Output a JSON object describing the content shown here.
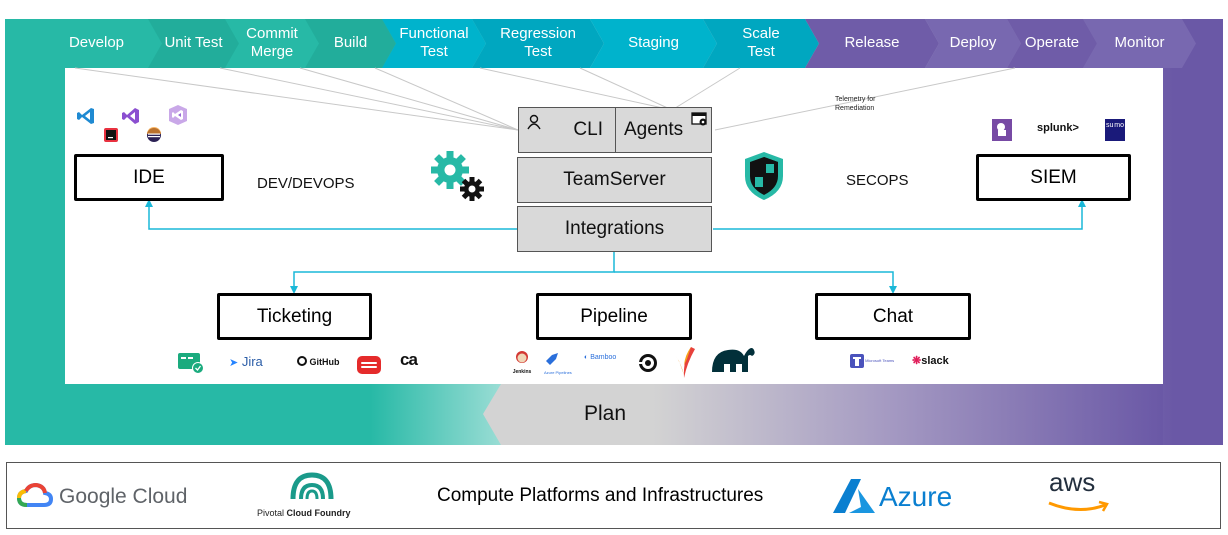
{
  "stages": [
    {
      "label": "Develop",
      "phase": "dev"
    },
    {
      "label": "Unit Test",
      "phase": "dev"
    },
    {
      "label": "Commit\nMerge",
      "phase": "dev"
    },
    {
      "label": "Build",
      "phase": "dev"
    },
    {
      "label": "Functional\nTest",
      "phase": "test"
    },
    {
      "label": "Regression\nTest",
      "phase": "test"
    },
    {
      "label": "Staging",
      "phase": "test"
    },
    {
      "label": "Scale\nTest",
      "phase": "test"
    },
    {
      "label": "Release",
      "phase": "ops"
    },
    {
      "label": "Deploy",
      "phase": "ops"
    },
    {
      "label": "Operate",
      "phase": "ops"
    },
    {
      "label": "Monitor",
      "phase": "ops"
    }
  ],
  "colors": {
    "dev": "#27b9a6",
    "test": "#00b3cc",
    "ops": "#6f5ca8",
    "connector": "#1ab8d8",
    "core_box": "#d9d9d9",
    "fan_line": "#c8c8c8"
  },
  "core": {
    "cli": "CLI",
    "agents": "Agents",
    "teamserver": "TeamServer",
    "integrations": "Integrations"
  },
  "left": {
    "ide": "IDE",
    "devops_label": "DEV/DEVOPS",
    "ide_logos": [
      "vscode-icon",
      "visual-studio-icon",
      "visual-studio-alt-icon",
      "intellij-icon",
      "eclipse-icon"
    ]
  },
  "right": {
    "siem": "SIEM",
    "secops_label": "SECOPS",
    "telemetry_label": "Telemetry for\nRemediation",
    "siem_logos": [
      "datadog-icon",
      "splunk",
      "sumo-logic-icon"
    ],
    "splunk_text": "splunk>",
    "sumo_text": "su mo"
  },
  "bottom_targets": [
    {
      "label": "Ticketing",
      "logos": [
        "azure-boards-icon",
        "Jira",
        "GitHub",
        "redhat-icon",
        "ca"
      ]
    },
    {
      "label": "Pipeline",
      "logos": [
        "jenkins-icon",
        "Azure Pipelines",
        "Bamboo",
        "circleci-icon",
        "apache-maven-icon",
        "gradle-elephant-icon"
      ]
    },
    {
      "label": "Chat",
      "logos": [
        "Microsoft Teams",
        "slack"
      ]
    }
  ],
  "logo_text": {
    "jira": "Jira",
    "github": "GitHub",
    "ca": "ca",
    "jenkins": "Jenkins",
    "azure_pipelines": "Azure Pipelines",
    "bamboo": "Bamboo",
    "teams": "Microsoft Teams",
    "slack": "slack"
  },
  "plan": "Plan",
  "platforms": {
    "title": "Compute Platforms and Infrastructures",
    "google": "Google Cloud",
    "pivotal_a": "Pivotal ",
    "pivotal_b": "Cloud Foundry",
    "azure": "Azure",
    "aws": "aws"
  }
}
